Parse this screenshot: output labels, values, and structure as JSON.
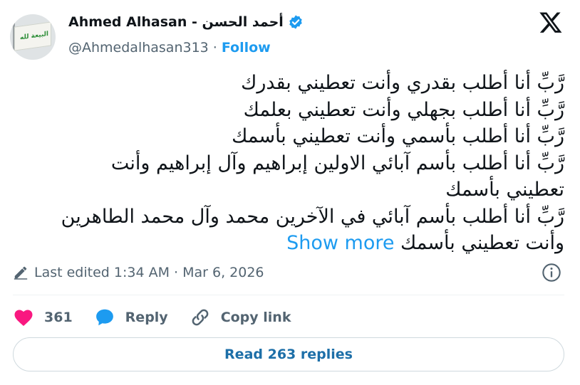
{
  "author": {
    "name": "Ahmed Alhasan - أحمد الحسن",
    "handle": "@Ahmedalhasan313",
    "follow_label": "Follow",
    "avatar_flag_text": "البيعة لله",
    "verified_icon": "verified-badge-icon"
  },
  "brand_icon": "x-logo-icon",
  "tweet": {
    "lines": [
      "رَّبِّ أنا أطلب بقدري وأنت تعطيني بقدرك",
      "رَّبِّ أنا أطلب بجهلي وأنت تعطيني بعلمك",
      "رَّبِّ أنا أطلب بأسمي وأنت تعطيني بأسمك",
      "رَّبِّ أنا أطلب بأسم آبائي الاولين إبراهيم وآل إبراهيم وأنت",
      "تعطيني بأسمك",
      "رَّبِّ أنا أطلب بأسم آبائي في الآخرين محمد وآل محمد الطاهرين",
      "وأنت تعطيني بأسمك"
    ],
    "show_more": "Show more"
  },
  "meta": {
    "edited": "Last edited 1:34 AM · Mar 6, 2026"
  },
  "actions": {
    "like_count": "361",
    "reply_label": "Reply",
    "copy_label": "Copy link"
  },
  "read_replies_label": "Read 263 replies",
  "colors": {
    "accent": "#1d9bf0",
    "like": "#f91880",
    "muted": "#536471",
    "text": "#0f1419"
  }
}
